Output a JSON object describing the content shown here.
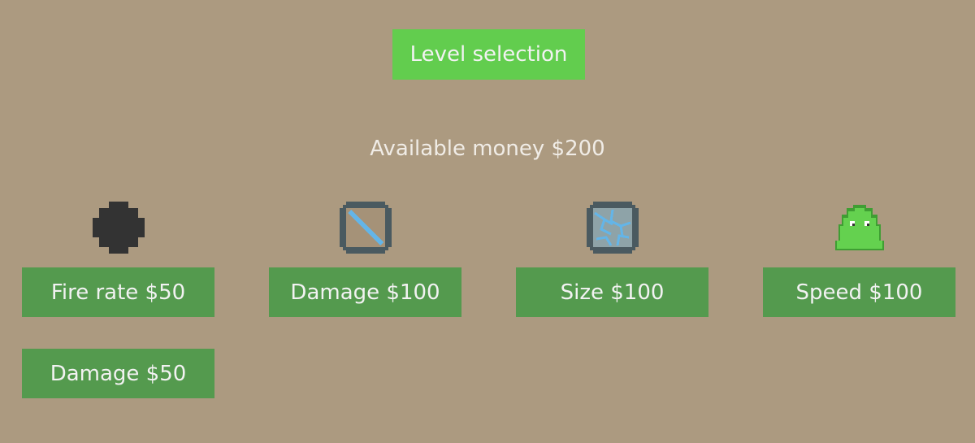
{
  "header": {
    "level_selection_label": "Level selection"
  },
  "money": {
    "text": "Available money $200"
  },
  "upgrades": [
    {
      "label": "Fire rate $50",
      "icon": "bullet-icon"
    },
    {
      "label": "Damage $100",
      "icon": "laser-tile-icon"
    },
    {
      "label": "Size $100",
      "icon": "electric-tile-icon"
    },
    {
      "label": "Speed $100",
      "icon": "slime-icon"
    },
    {
      "label": "Damage $50"
    }
  ],
  "colors": {
    "background": "#ac9a80",
    "primary_button": "#62cd4e",
    "upgrade_button": "#549a4e",
    "text": "#f2f2f2"
  }
}
